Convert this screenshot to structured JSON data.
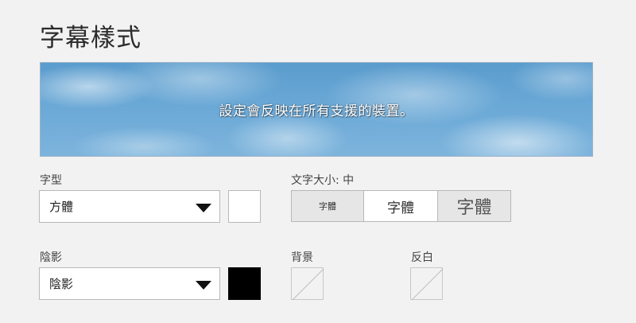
{
  "title": "字幕樣式",
  "preview": {
    "text": "設定會反映在所有支援的裝置。"
  },
  "font": {
    "label": "字型",
    "selected": "方體",
    "color": "#ffffff"
  },
  "text_size": {
    "label": "文字大小: 中",
    "options": [
      "字體",
      "字體",
      "字體"
    ],
    "selected_index": 1
  },
  "shadow": {
    "label": "陰影",
    "selected": "陰影",
    "color": "#000000"
  },
  "background": {
    "label": "背景"
  },
  "inverse": {
    "label": "反白"
  }
}
